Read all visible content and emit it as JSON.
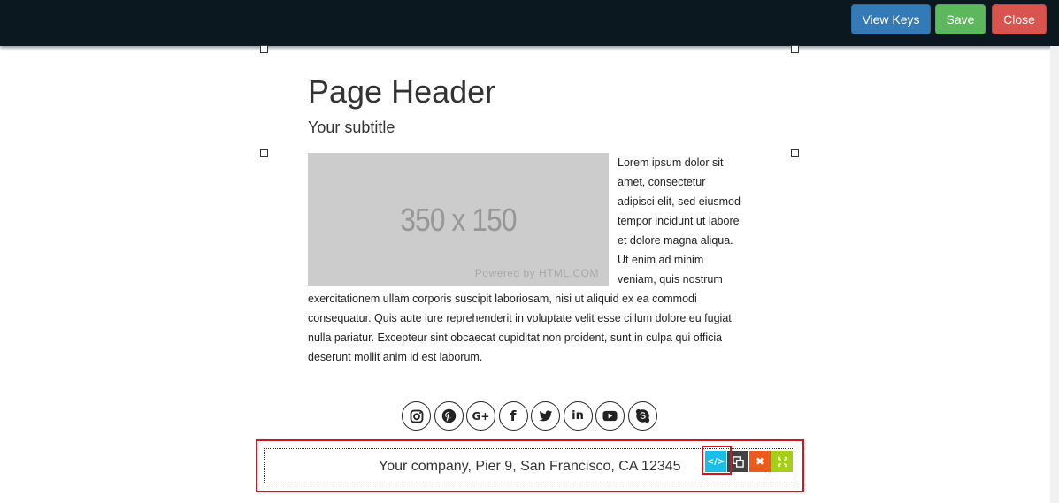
{
  "toolbar": {
    "view_keys_label": "View Keys",
    "save_label": "Save",
    "close_label": "Close"
  },
  "page": {
    "title": "Page Header",
    "subtitle": "Your subtitle",
    "image_placeholder": {
      "size_label": "350 x 150",
      "powered_by": "Powered by HTML.COM"
    },
    "body_side_lines": [
      "Lorem ipsum dolor sit",
      "amet, consectetur",
      "adipisci elit, sed eiusmod",
      "tempor incidunt ut labore",
      "et dolore magna aliqua.",
      "Ut enim ad minim",
      "veniam, quis nostrum"
    ],
    "body_full_lines": [
      "exercitationem ullam corporis suscipit laboriosam, nisi ut aliquid ex ea commodi",
      "consequatur. Quis aute iure reprehenderit in voluptate velit esse cillum dolore eu fugiat",
      "nulla pariatur. Excepteur sint obcaecat cupiditat non proident, sunt in culpa qui officia",
      "deserunt mollit anim id est laborum."
    ]
  },
  "social": {
    "icons": [
      "instagram-icon",
      "pinterest-icon",
      "google-plus-icon",
      "facebook-icon",
      "twitter-icon",
      "linkedin-icon",
      "youtube-icon",
      "skype-icon"
    ],
    "google_plus_glyph": "G+",
    "facebook_glyph": "f",
    "linkedin_glyph": "in"
  },
  "footer": {
    "address": "Your company, Pier 9, San Francisco, CA 12345",
    "tools": {
      "code_glyph": "</>",
      "delete_glyph": "✖"
    }
  },
  "colors": {
    "topbar": "#0c1820",
    "view_keys": "#337ab7",
    "save": "#5cb85c",
    "close": "#d9534f",
    "selection_border": "#d0161e",
    "tool_code": "#19bde7",
    "tool_copy": "#424242",
    "tool_delete": "#ee5a1d",
    "tool_move": "#a4cf16"
  }
}
